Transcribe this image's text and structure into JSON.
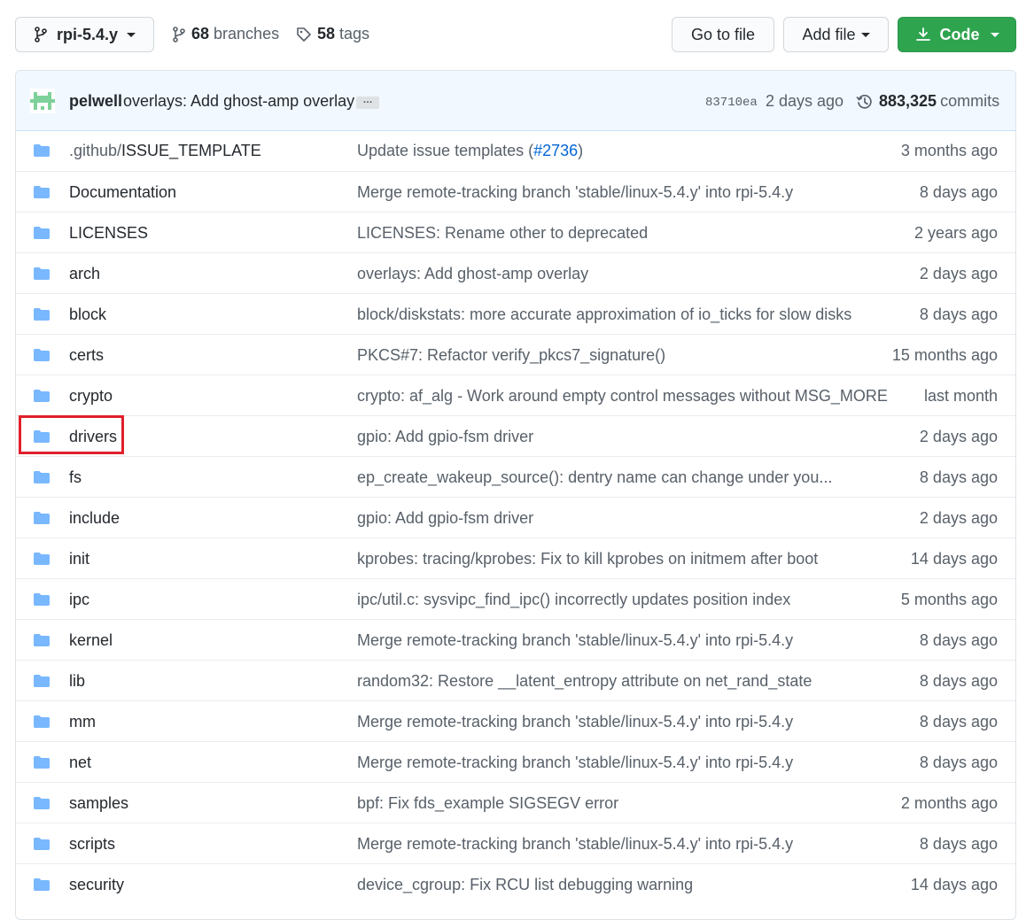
{
  "toolbar": {
    "branch": "rpi-5.4.y",
    "branches_count": "68",
    "branches_label": "branches",
    "tags_count": "58",
    "tags_label": "tags",
    "goto_label": "Go to file",
    "add_label": "Add file",
    "code_label": "Code"
  },
  "commit": {
    "author": "pelwell",
    "message": "overlays: Add ghost-amp overlay",
    "ellipsis": "…",
    "sha": "83710ea",
    "age": "2 days ago",
    "commits_count": "883,325",
    "commits_label": "commits"
  },
  "colors": {
    "folder": "#79b8ff",
    "link": "#0366d6",
    "primary_button": "#2ea44f",
    "highlight": "#e0202a"
  },
  "rows": [
    {
      "prefix": ".github/",
      "name": "ISSUE_TEMPLATE",
      "msg": "Update issue templates (",
      "msg_link": "#2736",
      "msg_suffix": ")",
      "age": "3 months ago"
    },
    {
      "name": "Documentation",
      "msg": "Merge remote-tracking branch 'stable/linux-5.4.y' into rpi-5.4.y",
      "age": "8 days ago"
    },
    {
      "name": "LICENSES",
      "msg": "LICENSES: Rename other to deprecated",
      "age": "2 years ago"
    },
    {
      "name": "arch",
      "msg": "overlays: Add ghost-amp overlay",
      "age": "2 days ago"
    },
    {
      "name": "block",
      "msg": "block/diskstats: more accurate approximation of io_ticks for slow disks",
      "age": "8 days ago"
    },
    {
      "name": "certs",
      "msg": "PKCS#7: Refactor verify_pkcs7_signature()",
      "age": "15 months ago"
    },
    {
      "name": "crypto",
      "msg": "crypto: af_alg - Work around empty control messages without MSG_MORE",
      "age": "last month"
    },
    {
      "name": "drivers",
      "msg": "gpio: Add gpio-fsm driver",
      "age": "2 days ago"
    },
    {
      "name": "fs",
      "msg": "ep_create_wakeup_source(): dentry name can change under you...",
      "age": "8 days ago"
    },
    {
      "name": "include",
      "msg": "gpio: Add gpio-fsm driver",
      "age": "2 days ago"
    },
    {
      "name": "init",
      "msg": "kprobes: tracing/kprobes: Fix to kill kprobes on initmem after boot",
      "age": "14 days ago"
    },
    {
      "name": "ipc",
      "msg": "ipc/util.c: sysvipc_find_ipc() incorrectly updates position index",
      "age": "5 months ago"
    },
    {
      "name": "kernel",
      "msg": "Merge remote-tracking branch 'stable/linux-5.4.y' into rpi-5.4.y",
      "age": "8 days ago"
    },
    {
      "name": "lib",
      "msg": "random32: Restore __latent_entropy attribute on net_rand_state",
      "age": "8 days ago"
    },
    {
      "name": "mm",
      "msg": "Merge remote-tracking branch 'stable/linux-5.4.y' into rpi-5.4.y",
      "age": "8 days ago"
    },
    {
      "name": "net",
      "msg": "Merge remote-tracking branch 'stable/linux-5.4.y' into rpi-5.4.y",
      "age": "8 days ago"
    },
    {
      "name": "samples",
      "msg": "bpf: Fix fds_example SIGSEGV error",
      "age": "2 months ago"
    },
    {
      "name": "scripts",
      "msg": "Merge remote-tracking branch 'stable/linux-5.4.y' into rpi-5.4.y",
      "age": "8 days ago"
    },
    {
      "name": "security",
      "msg": "device_cgroup: Fix RCU list debugging warning",
      "age": "14 days ago"
    }
  ]
}
